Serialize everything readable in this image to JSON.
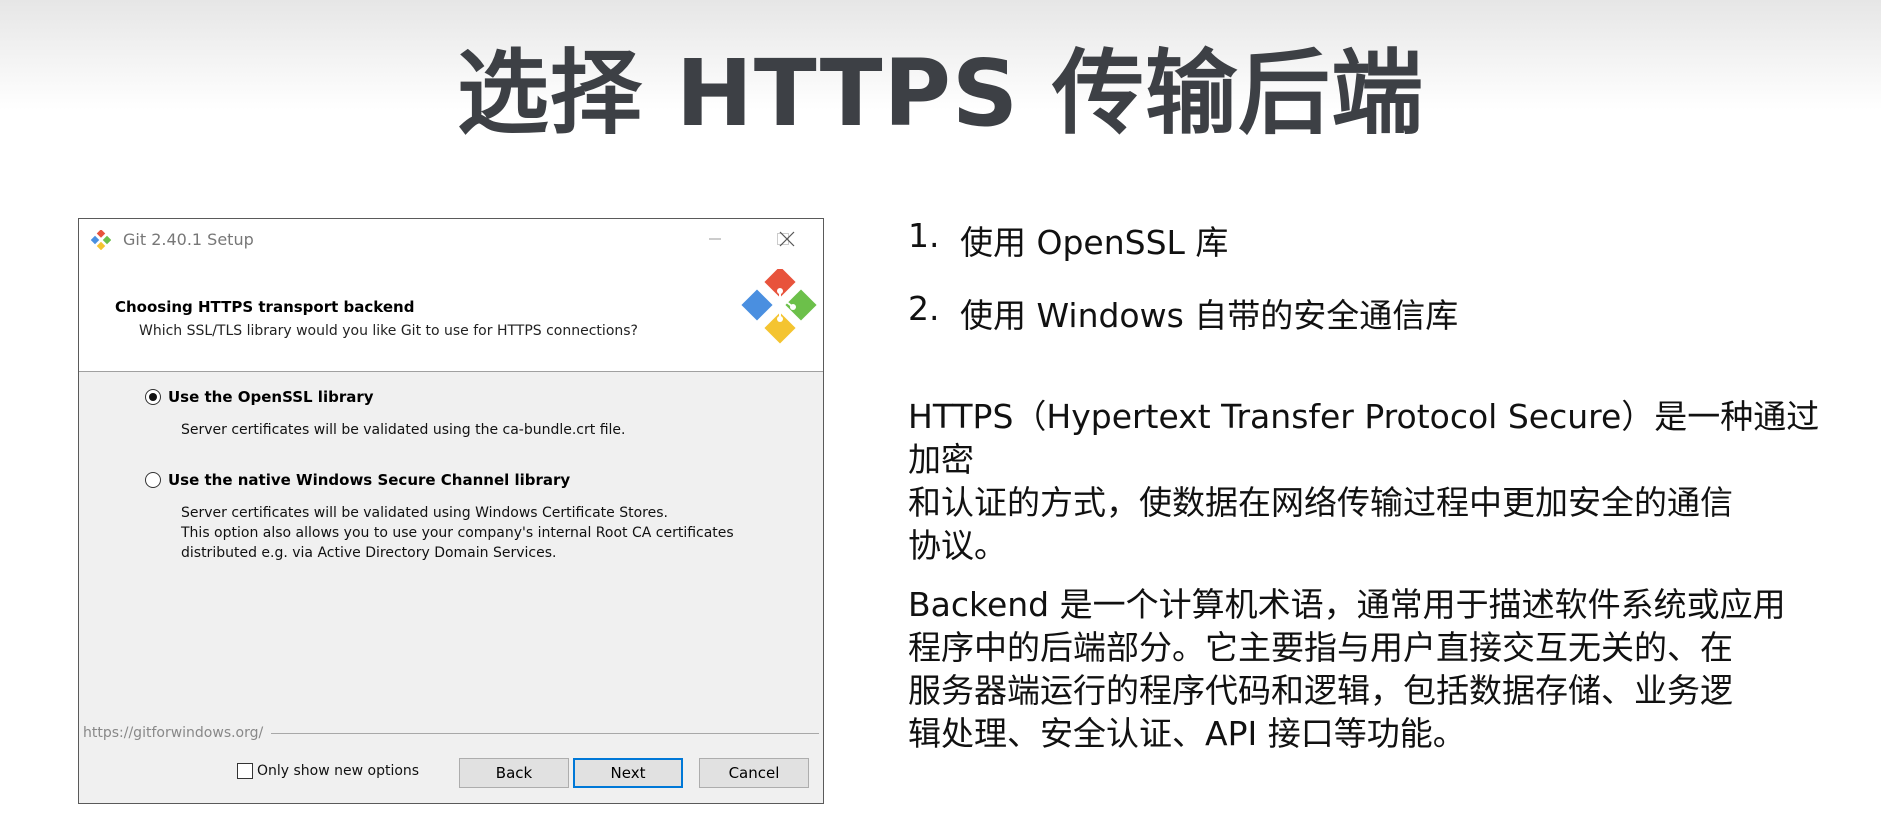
{
  "slide": {
    "title": "选择 HTTPS 传输后端"
  },
  "dialog": {
    "window_title": "Git 2.40.1 Setup",
    "header_title": "Choosing HTTPS transport backend",
    "header_subtitle": "Which SSL/TLS library would you like Git to use for HTTPS connections?",
    "options": [
      {
        "label": "Use the OpenSSL library",
        "selected": true,
        "description": [
          "Server certificates will be validated using the ca-bundle.crt file."
        ]
      },
      {
        "label": "Use the native Windows Secure Channel library",
        "selected": false,
        "description": [
          "Server certificates will be validated using Windows Certificate Stores.",
          "This option also allows you to use your company's internal Root CA certificates",
          "distributed e.g. via Active Directory Domain Services."
        ]
      }
    ],
    "url": "https://gitforwindows.org/",
    "only_new_options_label": "Only show new options",
    "only_new_options_checked": false,
    "back_label": "Back",
    "next_label": "Next",
    "cancel_label": "Cancel",
    "accent_color": "#0078d7"
  },
  "notes": {
    "list": [
      {
        "num": "1.",
        "text": "使用 OpenSSL 库"
      },
      {
        "num": "2.",
        "text": "使用 Windows 自带的安全通信库"
      }
    ],
    "https_paragraph": [
      "HTTPS（Hypertext Transfer Protocol Secure）是一种通过加密",
      "和认证的方式，使数据在网络传输过程中更加安全的通信",
      "协议。"
    ],
    "backend_paragraph": [
      "Backend 是一个计算机术语，通常用于描述软件系统或应用",
      "程序中的后端部分。它主要指与用户直接交互无关的、在",
      "服务器端运行的程序代码和逻辑，包括数据存储、业务逻",
      "辑处理、安全认证、API 接口等功能。"
    ]
  }
}
